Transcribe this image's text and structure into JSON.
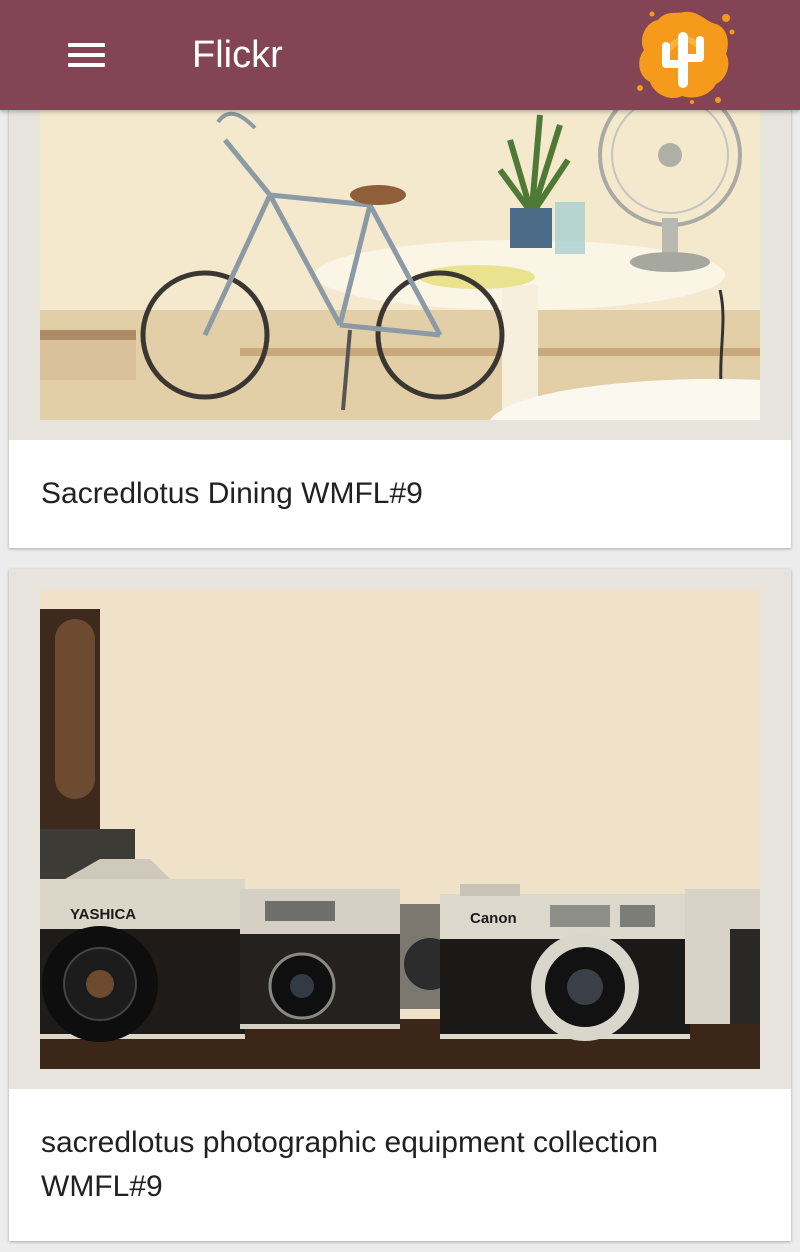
{
  "app_bar": {
    "title": "Flickr",
    "background_color": "#834455",
    "menu_icon": "hamburger-menu-icon",
    "logo_icon": "orange-cactus-splash-logo-icon"
  },
  "feed": {
    "items": [
      {
        "caption": "Sacredlotus Dining WMFL#9",
        "photo_subject": "bicycle-table-fan-photo"
      },
      {
        "caption": "sacredlotus photographic equipment collection WMFL#9",
        "photo_subject": "vintage-cameras-photo",
        "camera_labels": [
          "YASHICA",
          "Canon"
        ]
      }
    ]
  }
}
